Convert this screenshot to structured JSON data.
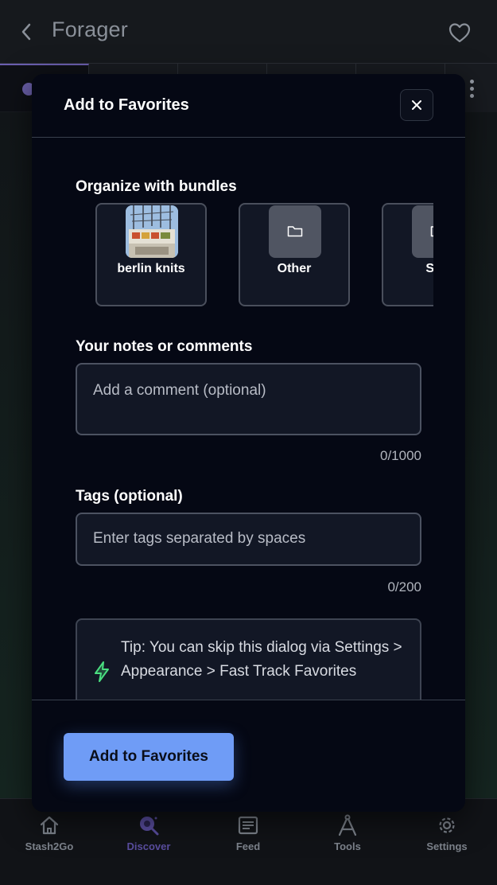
{
  "app": {
    "title": "Forager"
  },
  "bottom_nav": {
    "items": [
      {
        "label": "Stash2Go",
        "icon": "home-icon",
        "active": false
      },
      {
        "label": "Discover",
        "icon": "search-icon",
        "active": true
      },
      {
        "label": "Feed",
        "icon": "feed-icon",
        "active": false
      },
      {
        "label": "Tools",
        "icon": "tools-icon",
        "active": false
      },
      {
        "label": "Settings",
        "icon": "gear-icon",
        "active": false
      }
    ]
  },
  "dialog": {
    "title": "Add to Favorites",
    "bundles": {
      "label": "Organize with bundles",
      "items": [
        {
          "name": "berlin knits",
          "icon": "photo-thumbnail"
        },
        {
          "name": "Other",
          "icon": "folder-icon"
        },
        {
          "name": "Sha",
          "icon": "folder-icon"
        }
      ]
    },
    "notes": {
      "label": "Your notes or comments",
      "placeholder": "Add a comment (optional)",
      "counter": "0/1000"
    },
    "tags": {
      "label": "Tags (optional)",
      "placeholder": "Enter tags separated by spaces",
      "counter": "0/200"
    },
    "tip": {
      "text": "Tip: You can skip this dialog via Settings > Appearance > Fast Track Favorites",
      "icon": "lightning-icon"
    },
    "submit_label": "Add to Favorites"
  },
  "colors": {
    "accent": "#6f9cf6",
    "tip_icon": "#4ade80",
    "active_nav": "#5a4ea0"
  }
}
